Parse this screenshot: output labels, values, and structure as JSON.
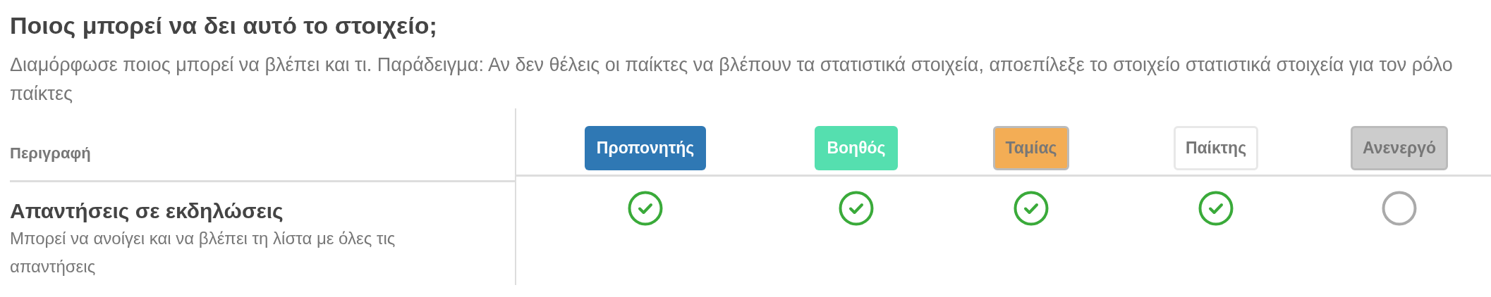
{
  "title": "Ποιος μπορεί να δει αυτό το στοιχείο;",
  "description": "Διαμόρφωσε ποιος μπορεί να βλέπει και τι. Παράδειγμα: Αν δεν θέλεις οι παίκτες να βλέπουν τα στατιστικά στοιχεία, αποεπίλεξε το στοιχείο στατιστικά στοιχεία για τον ρόλο παίκτες",
  "table": {
    "description_column": "Περιγραφή",
    "roles": [
      {
        "label": "Προπονητής",
        "color": "#2f78b4"
      },
      {
        "label": "Βοηθός",
        "color": "#55dfaf"
      },
      {
        "label": "Ταμίας",
        "color": "#f3ad55"
      },
      {
        "label": "Παίκτης",
        "color": "#ffffff"
      },
      {
        "label": "Ανενεργό",
        "color": "#cccccc"
      }
    ],
    "rows": [
      {
        "title": "Απαντήσεις σε εκδηλώσεις",
        "subtitle": "Μπορεί να ανοίγει και να βλέπει τη λίστα με όλες τις απαντήσεις",
        "permissions": [
          {
            "checked": true
          },
          {
            "checked": true
          },
          {
            "checked": true
          },
          {
            "checked": true
          },
          {
            "checked": false
          }
        ]
      }
    ]
  }
}
